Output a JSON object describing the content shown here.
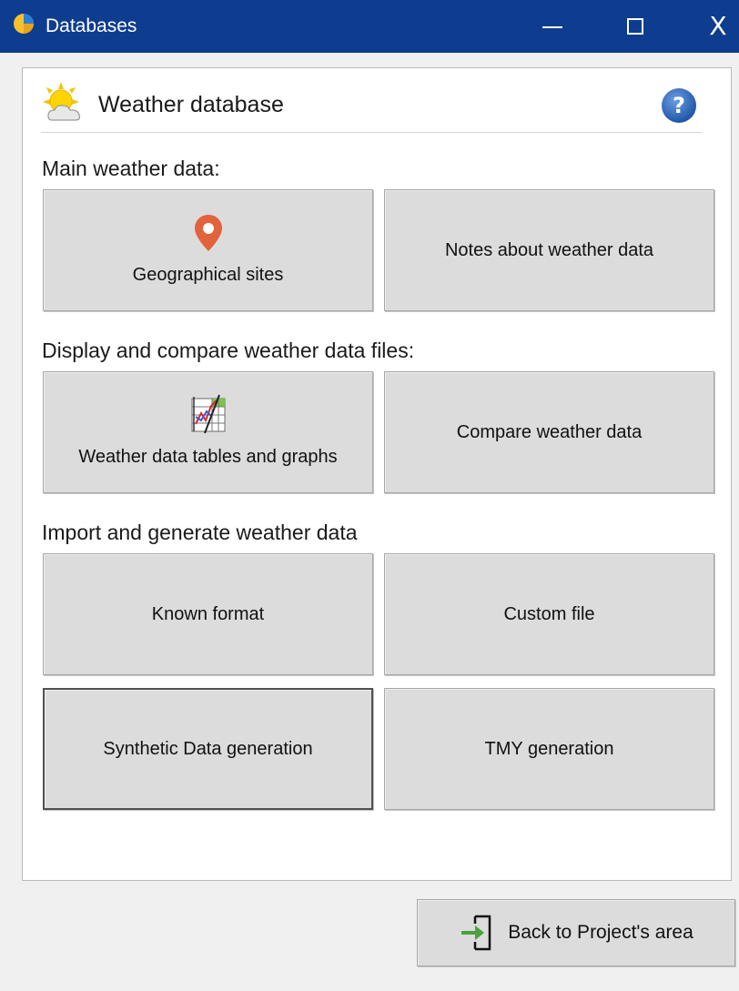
{
  "window": {
    "title": "Databases"
  },
  "header": {
    "title": "Weather database"
  },
  "sections": {
    "main": {
      "label": "Main weather data:",
      "buttons": {
        "geo": "Geographical sites",
        "notes": "Notes about weather data"
      }
    },
    "display": {
      "label": "Display and compare weather data files:",
      "buttons": {
        "tables": "Weather data tables and graphs",
        "compare": "Compare weather data"
      }
    },
    "import": {
      "label": "Import and generate weather data",
      "buttons": {
        "known": "Known format",
        "custom": "Custom file",
        "synthetic": "Synthetic Data generation",
        "tmy": "TMY generation"
      }
    }
  },
  "footer": {
    "back_label": "Back to Project's area"
  },
  "colors": {
    "titlebar": "#0e3d8f",
    "button_face": "#dcdcdc",
    "panel": "#ffffff",
    "pin": "#e2623b",
    "help": "#2b63b8",
    "back_arrow": "#4aa23a"
  },
  "icons": {
    "app": "app-logo-icon",
    "weather": "sun-cloud-icon",
    "help": "help-question-icon",
    "geo": "map-pin-icon",
    "tables": "table-graph-icon",
    "back": "exit-arrow-icon"
  }
}
